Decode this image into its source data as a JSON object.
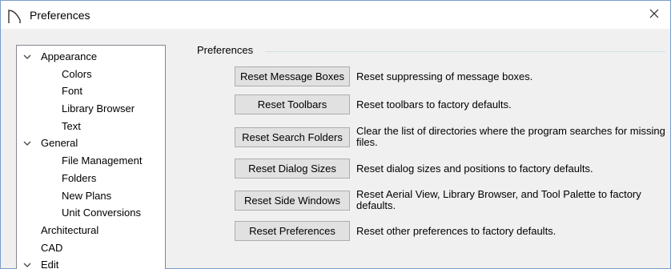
{
  "window": {
    "title": "Preferences",
    "icon": "arch-icon",
    "close_glyph": "✕"
  },
  "tree": {
    "items": [
      {
        "label": "Appearance",
        "expanded": true,
        "level": 0
      },
      {
        "label": "Colors",
        "level": 1
      },
      {
        "label": "Font",
        "level": 1
      },
      {
        "label": "Library Browser",
        "level": 1
      },
      {
        "label": "Text",
        "level": 1
      },
      {
        "label": "General",
        "expanded": true,
        "level": 0
      },
      {
        "label": "File Management",
        "level": 1
      },
      {
        "label": "Folders",
        "level": 1
      },
      {
        "label": "New Plans",
        "level": 1
      },
      {
        "label": "Unit Conversions",
        "level": 1
      },
      {
        "label": "Architectural",
        "level": 0
      },
      {
        "label": "CAD",
        "level": 0
      },
      {
        "label": "Edit",
        "expanded": true,
        "level": 0
      }
    ]
  },
  "panel": {
    "group_title": "Preferences",
    "rows": [
      {
        "button": "Reset Message Boxes",
        "description": "Reset suppressing of message boxes."
      },
      {
        "button": "Reset Toolbars",
        "description": "Reset toolbars to factory defaults."
      },
      {
        "button": "Reset Search Folders",
        "description": "Clear the list of directories where the program searches for missing files."
      },
      {
        "button": "Reset Dialog Sizes",
        "description": "Reset dialog sizes and positions to factory defaults."
      },
      {
        "button": "Reset Side Windows",
        "description": "Reset Aerial View, Library Browser, and Tool Palette to factory defaults."
      },
      {
        "button": "Reset Preferences",
        "description": "Reset other preferences to factory defaults."
      }
    ]
  }
}
